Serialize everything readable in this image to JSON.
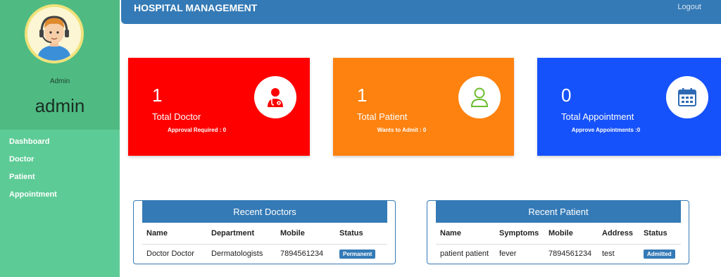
{
  "profile": {
    "role": "Admin",
    "username": "admin"
  },
  "nav": {
    "items": [
      {
        "label": "Dashboard"
      },
      {
        "label": "Doctor"
      },
      {
        "label": "Patient"
      },
      {
        "label": "Appointment"
      }
    ]
  },
  "header": {
    "title": "HOSPITAL MANAGEMENT",
    "logout": "Logout"
  },
  "cards": [
    {
      "count": "1",
      "label": "Total Doctor",
      "sub": "Approval Required : 0",
      "color": "#fe0000",
      "icon": "doctor-icon"
    },
    {
      "count": "1",
      "label": "Total Patient",
      "sub": "Wants to Admit : 0",
      "color": "#fd8210",
      "icon": "user-icon"
    },
    {
      "count": "0",
      "label": "Total Appointment",
      "sub": "Approve Appointments :0",
      "color": "#1652fb",
      "icon": "calendar-icon"
    }
  ],
  "recent_doctors": {
    "title": "Recent Doctors",
    "headers": [
      "Name",
      "Department",
      "Mobile",
      "Status"
    ],
    "rows": [
      {
        "name": "Doctor Doctor",
        "department": "Dermatologists",
        "mobile": "7894561234",
        "status": "Permanent"
      }
    ]
  },
  "recent_patients": {
    "title": "Recent Patient",
    "headers": [
      "Name",
      "Symptoms",
      "Mobile",
      "Address",
      "Status"
    ],
    "rows": [
      {
        "name": "patient patient",
        "symptoms": "fever",
        "mobile": "7894561234",
        "address": "test",
        "status": "Admitted"
      }
    ]
  },
  "colors": {
    "accent": "#347ab6",
    "sidebar": "#5dcb96",
    "sidebar_profile": "#4fbb83"
  }
}
